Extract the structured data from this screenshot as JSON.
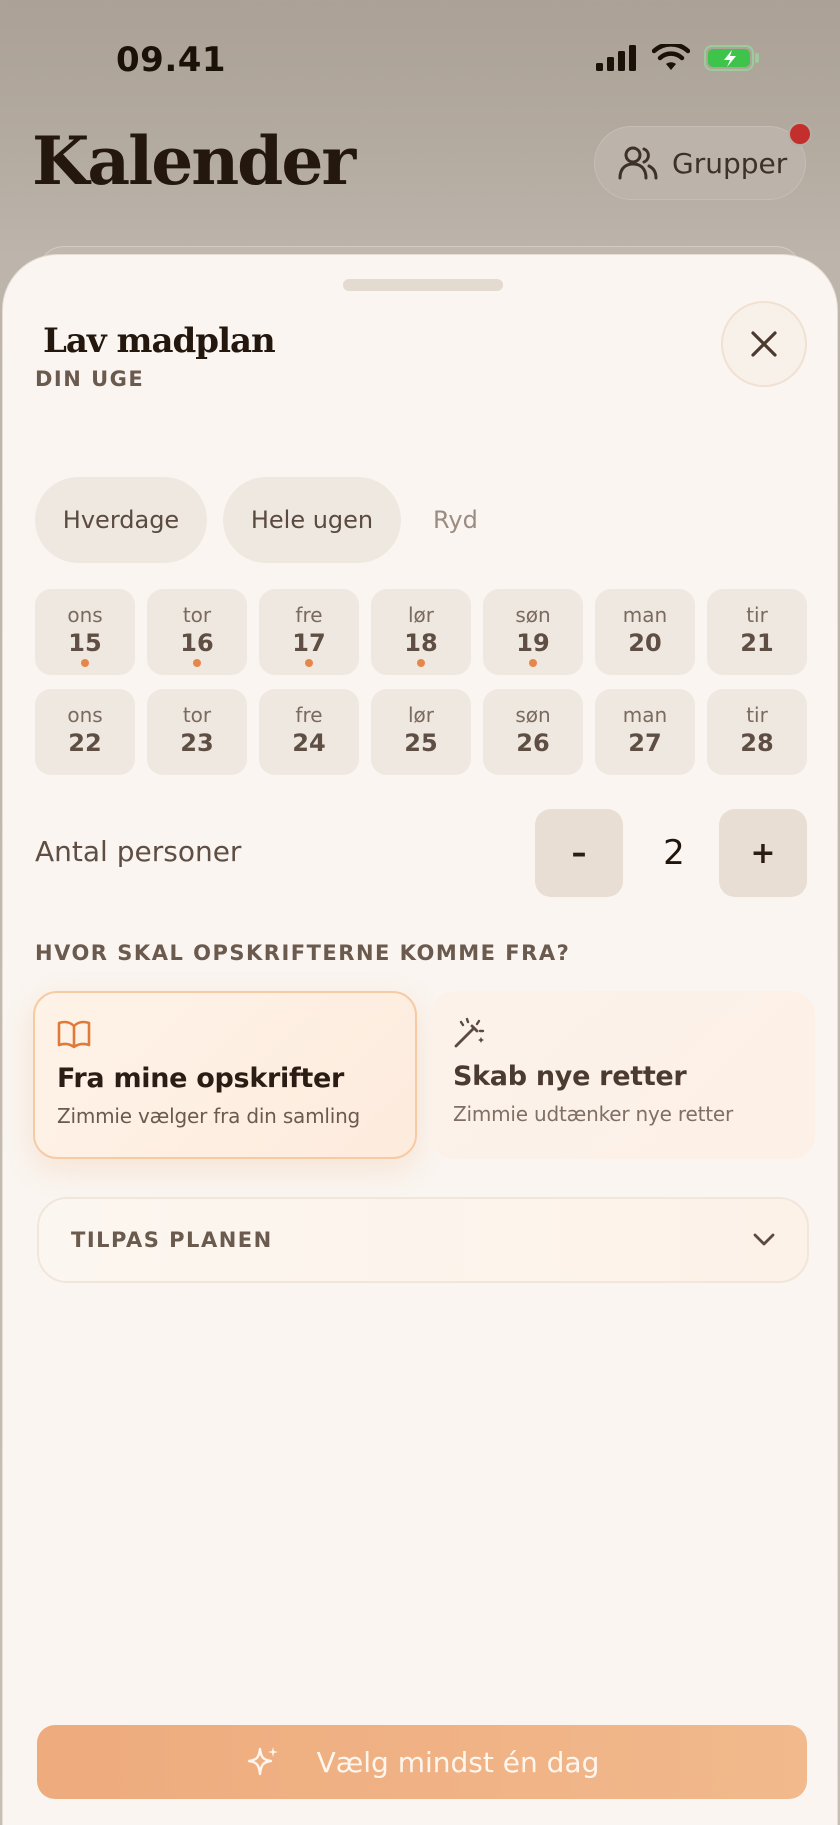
{
  "status_bar": {
    "time": "09.41"
  },
  "background": {
    "title": "Kalender",
    "groups_label": "Grupper"
  },
  "sheet": {
    "title": "Lav madplan",
    "week_section": {
      "label": "DIN UGE",
      "presets": [
        "Hverdage",
        "Hele ugen"
      ],
      "clear_label": "Ryd"
    },
    "days_row1": [
      {
        "name": "ons",
        "num": "15",
        "dot": true
      },
      {
        "name": "tor",
        "num": "16",
        "dot": true
      },
      {
        "name": "fre",
        "num": "17",
        "dot": true
      },
      {
        "name": "lør",
        "num": "18",
        "dot": true
      },
      {
        "name": "søn",
        "num": "19",
        "dot": true
      },
      {
        "name": "man",
        "num": "20",
        "dot": false
      },
      {
        "name": "tir",
        "num": "21",
        "dot": false
      }
    ],
    "days_row2": [
      {
        "name": "ons",
        "num": "22",
        "dot": false
      },
      {
        "name": "tor",
        "num": "23",
        "dot": false
      },
      {
        "name": "fre",
        "num": "24",
        "dot": false
      },
      {
        "name": "lør",
        "num": "25",
        "dot": false
      },
      {
        "name": "søn",
        "num": "26",
        "dot": false
      },
      {
        "name": "man",
        "num": "27",
        "dot": false
      },
      {
        "name": "tir",
        "num": "28",
        "dot": false
      }
    ],
    "persons": {
      "label": "Antal personer",
      "minus": "–",
      "value": "2",
      "plus": "+"
    },
    "source_section": {
      "label": "HVOR SKAL OPSKRIFTERNE KOMME FRA?",
      "options": [
        {
          "title": "Fra mine opskrifter",
          "subtitle": "Zimmie vælger fra din samling",
          "icon": "book-open-icon",
          "selected": true
        },
        {
          "title": "Skab nye retter",
          "subtitle": "Zimmie udtænker nye retter",
          "icon": "magic-wand-icon",
          "selected": false
        }
      ]
    },
    "customize_label": "TILPAS PLANEN",
    "cta_label": "Vælg mindst én dag"
  },
  "colors": {
    "accent": "#e8864a",
    "cta": "#eeab7d",
    "sheet_bg": "#faf5f0",
    "notification": "#c22f2c"
  }
}
